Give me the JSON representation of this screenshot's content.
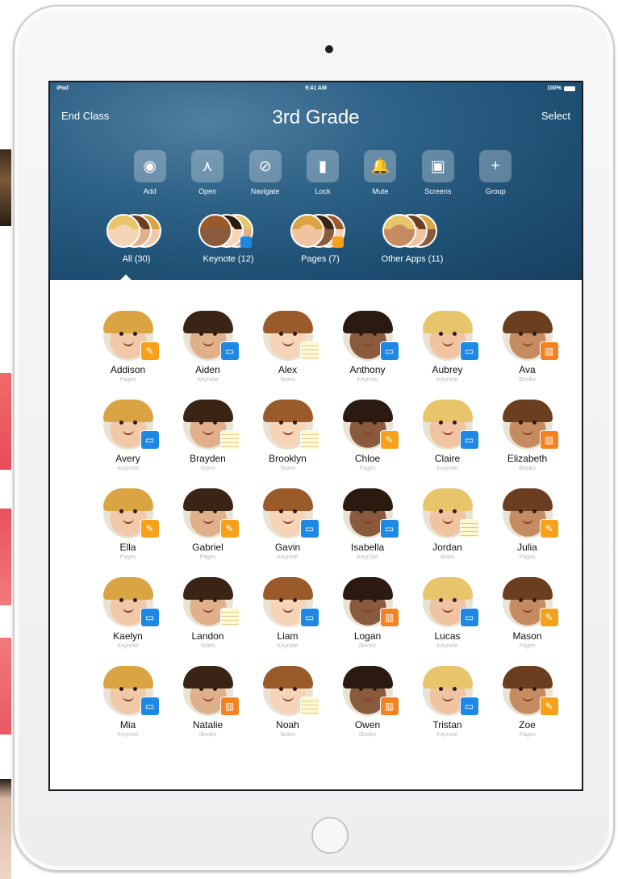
{
  "status_bar": {
    "carrier": "iPad",
    "time": "9:41 AM",
    "battery": "100%"
  },
  "header": {
    "end_class": "End Class",
    "title": "3rd Grade",
    "select": "Select"
  },
  "toolbar": [
    {
      "label": "Add",
      "icon": "add-person-icon",
      "glyph": "◉"
    },
    {
      "label": "Open",
      "icon": "open-app-icon",
      "glyph": "⋏"
    },
    {
      "label": "Navigate",
      "icon": "compass-icon",
      "glyph": "⊘"
    },
    {
      "label": "Lock",
      "icon": "lock-icon",
      "glyph": "▮"
    },
    {
      "label": "Mute",
      "icon": "mute-icon",
      "glyph": "🔔"
    },
    {
      "label": "Screens",
      "icon": "screens-icon",
      "glyph": "▣"
    },
    {
      "label": "Group",
      "icon": "plus-icon",
      "glyph": "+"
    }
  ],
  "groups": [
    {
      "label": "All (30)",
      "badge": null
    },
    {
      "label": "Keynote (12)",
      "badge": "#1e88e5"
    },
    {
      "label": "Pages (7)",
      "badge": "#f7a11a"
    },
    {
      "label": "Other Apps (11)",
      "badge": null
    }
  ],
  "students": [
    {
      "name": "Addison",
      "app": "Pages"
    },
    {
      "name": "Aiden",
      "app": "Keynote"
    },
    {
      "name": "Alex",
      "app": "Notes"
    },
    {
      "name": "Anthony",
      "app": "Keynote"
    },
    {
      "name": "Aubrey",
      "app": "Keynote"
    },
    {
      "name": "Ava",
      "app": "iBooks"
    },
    {
      "name": "Avery",
      "app": "Keynote"
    },
    {
      "name": "Brayden",
      "app": "Notes"
    },
    {
      "name": "Brooklyn",
      "app": "Notes"
    },
    {
      "name": "Chloe",
      "app": "Pages"
    },
    {
      "name": "Claire",
      "app": "Keynote"
    },
    {
      "name": "Elizabeth",
      "app": "iBooks"
    },
    {
      "name": "Ella",
      "app": "Pages"
    },
    {
      "name": "Gabriel",
      "app": "Pages"
    },
    {
      "name": "Gavin",
      "app": "Keynote"
    },
    {
      "name": "Isabella",
      "app": "Keynote"
    },
    {
      "name": "Jordan",
      "app": "Notes"
    },
    {
      "name": "Julia",
      "app": "Pages"
    },
    {
      "name": "Kaelyn",
      "app": "Keynote"
    },
    {
      "name": "Landon",
      "app": "Notes"
    },
    {
      "name": "Liam",
      "app": "Keynote"
    },
    {
      "name": "Logan",
      "app": "iBooks"
    },
    {
      "name": "Lucas",
      "app": "Keynote"
    },
    {
      "name": "Mason",
      "app": "Pages"
    },
    {
      "name": "Mia",
      "app": "Keynote"
    },
    {
      "name": "Natalie",
      "app": "iBooks"
    },
    {
      "name": "Noah",
      "app": "Notes"
    },
    {
      "name": "Owen",
      "app": "iBooks"
    },
    {
      "name": "Tristan",
      "app": "Keynote"
    },
    {
      "name": "Zoe",
      "app": "Pages"
    }
  ],
  "colors": {
    "header_blue": "#2f6287",
    "pages_badge": "#f7a11a",
    "keynote_badge": "#1e88e5",
    "ibooks_badge": "#f58220",
    "notes_badge": "#fff8cf"
  }
}
